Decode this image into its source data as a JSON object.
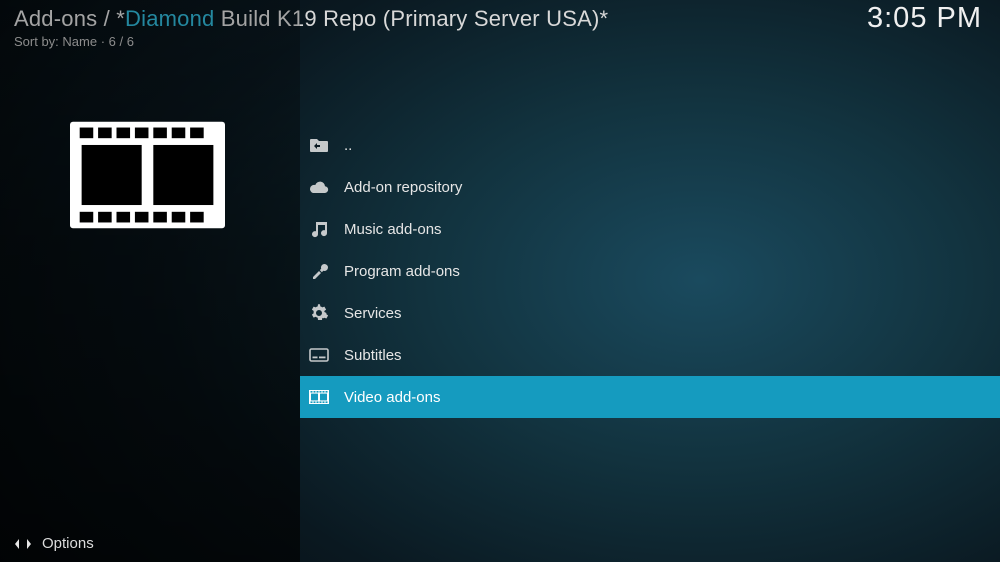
{
  "header": {
    "breadcrumb_prefix": "Add-ons /  *",
    "breadcrumb_accent": "Diamond",
    "breadcrumb_suffix": " Build K19 Repo (Primary Server USA)*",
    "sort_label": "Sort by: Name  ·  6 / 6",
    "clock": "3:05 PM"
  },
  "items": {
    "0": {
      "label": ".."
    },
    "1": {
      "label": "Add-on repository"
    },
    "2": {
      "label": "Music add-ons"
    },
    "3": {
      "label": "Program add-ons"
    },
    "4": {
      "label": "Services"
    },
    "5": {
      "label": "Subtitles"
    },
    "6": {
      "label": "Video add-ons"
    }
  },
  "footer": {
    "options": "Options"
  }
}
